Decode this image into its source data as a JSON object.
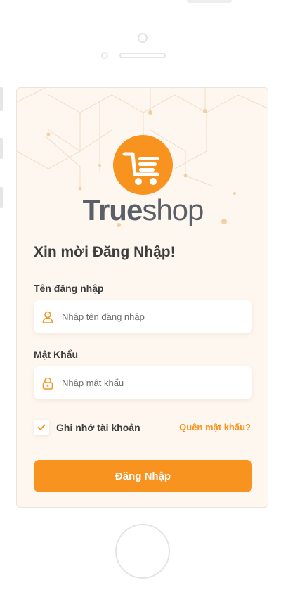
{
  "colors": {
    "accent": "#f7931e",
    "text": "#3d3d3d",
    "screen_bg": "#fdf7f0",
    "brand_text": "#5a5f68"
  },
  "brand": {
    "part1": "True",
    "part2": "shop",
    "logo_icon": "shopping-cart-icon"
  },
  "welcome": "Xin mời Đăng Nhập!",
  "username": {
    "label": "Tên đăng nhập",
    "placeholder": "Nhập tên đăng nhập",
    "value": "",
    "icon": "user-icon"
  },
  "password": {
    "label": "Mật Khẩu",
    "placeholder": "Nhập mật khẩu",
    "value": "",
    "icon": "lock-icon"
  },
  "remember": {
    "label": "Ghi nhớ tài khoản",
    "checked": true
  },
  "forgot_label": "Quên mật khẩu?",
  "login_label": "Đăng Nhập"
}
